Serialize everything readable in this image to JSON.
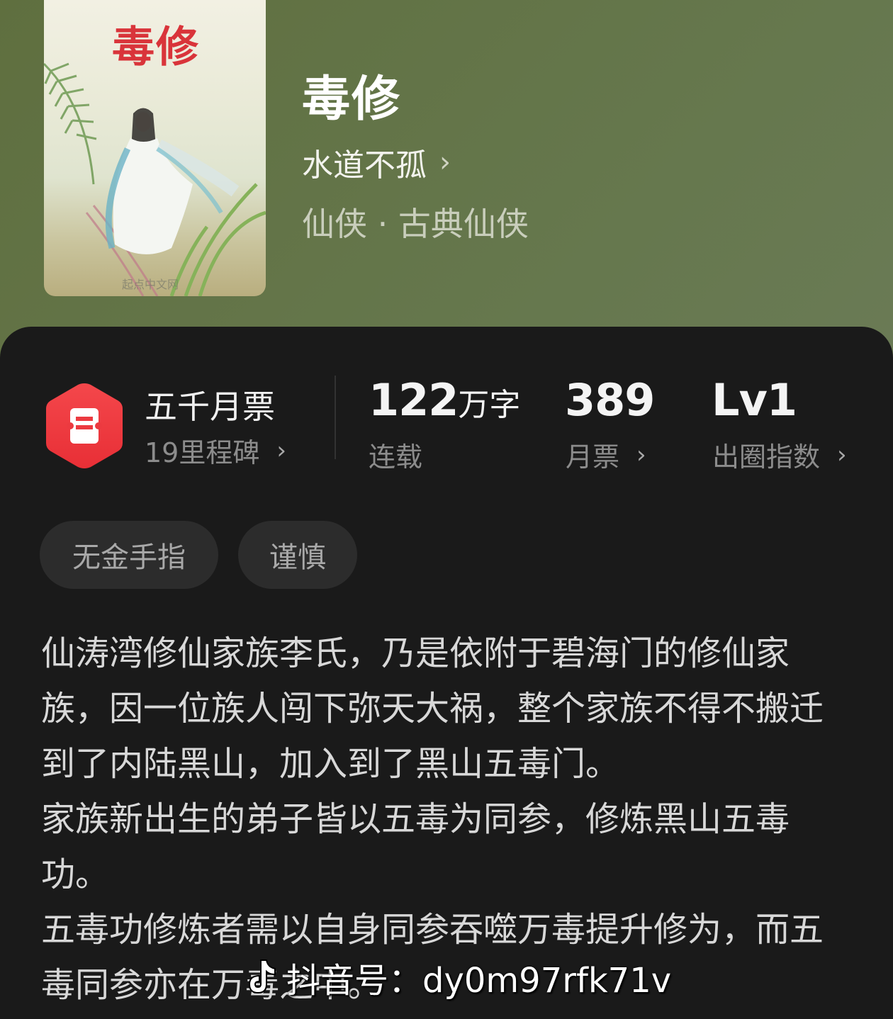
{
  "book": {
    "cover_title": "毒修",
    "cover_publisher": "起点中文网",
    "title": "毒修",
    "author": "水道不孤",
    "genre": "仙侠 · 古典仙侠"
  },
  "stats": {
    "badge_title": "五千月票",
    "badge_sub": "19里程碑",
    "word_count_number": "122",
    "word_count_unit": "万字",
    "status": "连载",
    "monthly_votes": "389",
    "monthly_votes_label": "月票",
    "level": "Lv1",
    "level_label": "出圈指数"
  },
  "tags": [
    "无金手指",
    "谨慎"
  ],
  "description": [
    "仙涛湾修仙家族李氏，乃是依附于碧海门的修仙家族，因一位族人闯下弥天大祸，整个家族不得不搬迁到了内陆黑山，加入到了黑山五毒门。",
    "家族新出生的弟子皆以五毒为同参，修炼黑山五毒功。",
    "五毒功修炼者需以自身同参吞噬万毒提升修为，而五毒同参亦在万毒之中。"
  ],
  "watermark": "抖音号：dy0m97rfk71v",
  "colors": {
    "badge_red": "#f0393f",
    "panel_bg": "#1a1a1a",
    "header_green": "#66784e"
  }
}
